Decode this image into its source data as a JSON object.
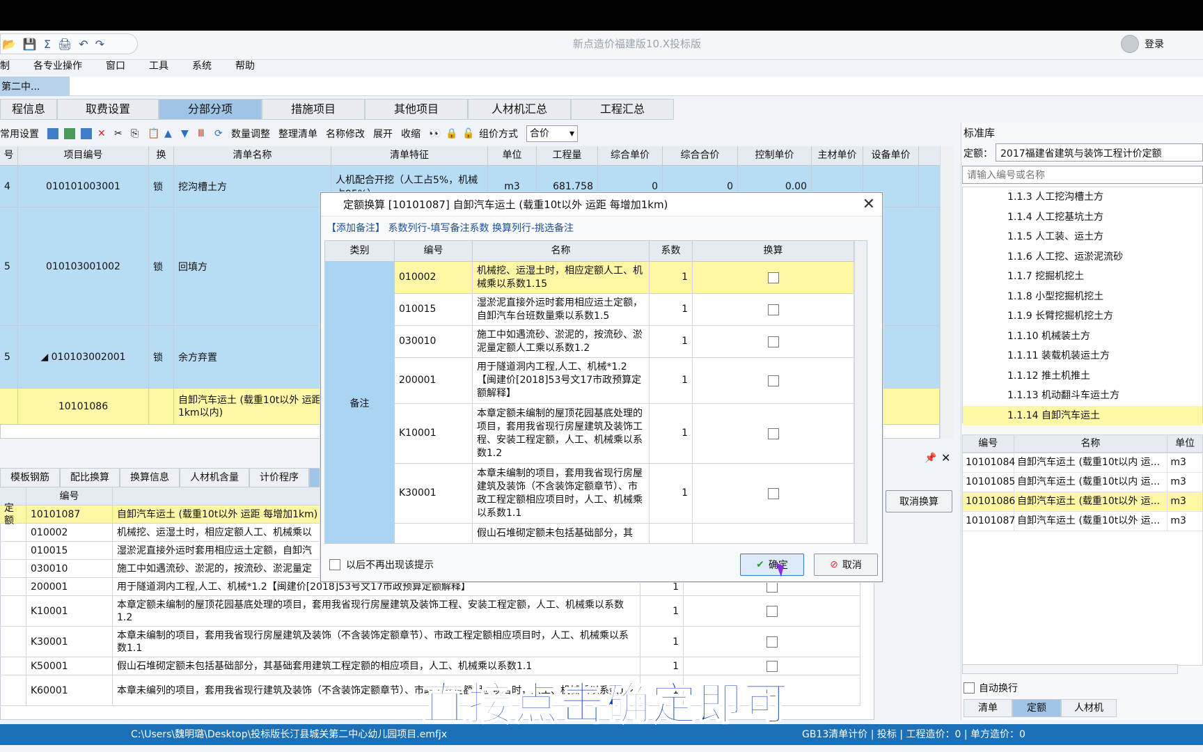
{
  "app": {
    "title": "新点造价福建版10.X投标版",
    "login": "登录"
  },
  "menu": [
    "制",
    "各专业操作",
    "窗口",
    "工具",
    "系统",
    "帮助"
  ],
  "doc_tab": "第二中...",
  "main_tabs": [
    "程信息",
    "取费设置",
    "分部分项",
    "措施项目",
    "其他项目",
    "人材机汇总",
    "工程汇总"
  ],
  "toolbar": {
    "settings": "常用设置",
    "qty_adjust": "数量调整",
    "organize": "整理清单",
    "rename": "名称修改",
    "expand": "展开",
    "collapse": "收缩",
    "group_label": "组价方式",
    "group_value": "合价"
  },
  "grid": {
    "headers": [
      "号",
      "项目编号",
      "换",
      "清单名称",
      "清单特征",
      "单位",
      "工程量",
      "综合单价",
      "综合合价",
      "控制单价",
      "主材单价",
      "设备单价"
    ],
    "rows": [
      {
        "no": "4",
        "code": "010101003001",
        "lock": "锁",
        "name": "挖沟槽土方",
        "feature": "人机配合开挖（人工占5%，机械占95%）",
        "unit": "m3",
        "qty": "681.758",
        "price": "0",
        "total": "0",
        "ctrl": "0.00"
      },
      {
        "no": "5",
        "code": "010103001002",
        "lock": "锁",
        "name": "回填方"
      },
      {
        "no": "5",
        "code": "◢ 010103002001",
        "lock": "锁",
        "name": "余方弃置"
      },
      {
        "no": "",
        "code": "10101086",
        "lock": "",
        "name": "自卸汽车运土 (载重10t以外 运距 1km以内)"
      }
    ]
  },
  "lower_tabs": [
    "模板钢筋",
    "配比换算",
    "换算信息",
    "人材机含量",
    "计价程序",
    "标"
  ],
  "lower_grid": {
    "header_code": "编号",
    "rows": [
      {
        "type": "定额",
        "code": "10101087",
        "name": "自卸汽车运土 (载重10t以外 运距 每增加1km)",
        "coef": ""
      },
      {
        "type": "",
        "code": "010002",
        "name": "机械挖、运湿土时，相应定额人工、机械乘以",
        "coef": ""
      },
      {
        "type": "",
        "code": "010015",
        "name": "湿淤泥直接外运时套用相应运土定额，自卸汽",
        "coef": ""
      },
      {
        "type": "",
        "code": "030010",
        "name": "施工中如遇流砂、淤泥的，按流砂、淤泥量定",
        "coef": ""
      },
      {
        "type": "",
        "code": "200001",
        "name": "用于隧道洞内工程,人工、机械*1.2【闽建价[2018]53号文17市政预算定额解释】",
        "coef": "1"
      },
      {
        "type": "",
        "code": "K10001",
        "name": "本章定额未编制的屋顶花园基底处理的项目，套用我省现行房屋建筑及装饰工程、安装工程定额，人工、机械乘以系数1.2",
        "coef": "1"
      },
      {
        "type": "",
        "code": "K30001",
        "name": "本章未编制的项目，套用我省现行房屋建筑及装饰（不含装饰定额章节）、市政工程定额相应项目时，人工、机械乘以系数1.1",
        "coef": "1"
      },
      {
        "type": "",
        "code": "K50001",
        "name": "假山石堆砌定额未包括基础部分，其基础套用建筑工程定额的相应项目，人工、机械乘以系数1.1",
        "coef": "1"
      },
      {
        "type": "",
        "code": "K60001",
        "name": "本章未编列的项目，套用我省现行建筑及装饰（不含装饰定额章节）、市政工程定额相应项目时，人工、机械乘以系数1.2",
        "coef": "1"
      }
    ]
  },
  "cancel_convert": "取消换算",
  "right": {
    "header": "标准库",
    "quota_label": "定额：",
    "quota_value": "2017福建省建筑与装饰工程计价定额",
    "search_placeholder": "请输入编号或名称",
    "tree": [
      "1.1.3 人工挖沟槽土方",
      "1.1.4 人工挖基坑土方",
      "1.1.5 人工装、运土方",
      "1.1.6 人工挖、运淤泥流砂",
      "1.1.7 挖掘机挖土",
      "1.1.8 小型挖掘机挖土",
      "1.1.9 长臂挖掘机挖土方",
      "1.1.10 机械装土方",
      "1.1.11 装载机装运土方",
      "1.1.12 推土机推土",
      "1.1.13 机动翻斗车运土方",
      "1.1.14 自卸汽车运土"
    ],
    "list_headers": [
      "编号",
      "名称",
      "单位"
    ],
    "list": [
      {
        "code": "10101084",
        "name": "自卸汽车运土 (载重10t以内 运...",
        "unit": "m3"
      },
      {
        "code": "10101085",
        "name": "自卸汽车运土 (载重10t以内 运...",
        "unit": "m3"
      },
      {
        "code": "10101086",
        "name": "自卸汽车运土 (载重10t以外 运...",
        "unit": "m3"
      },
      {
        "code": "10101087",
        "name": "自卸汽车运土 (载重10t以外 运...",
        "unit": "m3"
      }
    ],
    "auto_wrap": "自动换行",
    "bottom_tabs": [
      "清单",
      "定额",
      "人材机"
    ]
  },
  "dialog": {
    "title": "定额换算  [10101087]  自卸汽车运土 (载重10t以外 运距 每增加1km)",
    "link1": "【添加备注】",
    "link2": "系数列行-填写备注系数  换算列行-挑选备注",
    "headers": [
      "类别",
      "编号",
      "名称",
      "系数",
      "换算"
    ],
    "category": "备注",
    "rows": [
      {
        "code": "010002",
        "name": "机械挖、运湿土时，相应定额人工、机械乘以系数1.15",
        "coef": "1"
      },
      {
        "code": "010015",
        "name": "湿淤泥直接外运时套用相应运土定额，自卸汽车台班数量乘以系数1.5",
        "coef": "1"
      },
      {
        "code": "030010",
        "name": "施工中如遇流砂、淤泥的，按流砂、淤泥量定额人工乘以系数1.2",
        "coef": "1"
      },
      {
        "code": "200001",
        "name": "用于隧道洞内工程,人工、机械*1.2【闽建价[2018]53号文17市政预算定额解释】",
        "coef": "1"
      },
      {
        "code": "K10001",
        "name": "本章定额未编制的屋顶花园基底处理的项目，套用我省现行房屋建筑及装饰工程、安装工程定额，人工、机械乘以系数1.2",
        "coef": "1"
      },
      {
        "code": "K30001",
        "name": "本章未编制的项目，套用我省现行房屋建筑及装饰（不含装饰定额章节）、市政工程定额相应项目时，人工、机械乘以系数1.1",
        "coef": "1"
      },
      {
        "code": "",
        "name": "假山石堆砌定额未包括基础部分，其",
        "coef": ""
      }
    ],
    "dont_show": "以后不再出现该提示",
    "ok": "确定",
    "cancel": "取消"
  },
  "status": {
    "path": "C:\\Users\\魏明璐\\Desktop\\投标版长汀县城关第二中心幼儿园项目.emfjx",
    "right": "GB13清单计价 | 投标 | 工程造价：0 | 单方造价：0"
  },
  "subtitle": "直接点击确定即可",
  "colors": {
    "highlight_yellow": "#fff7a6",
    "row_blue": "#b7dcf4",
    "status_blue": "#1b70b8"
  }
}
